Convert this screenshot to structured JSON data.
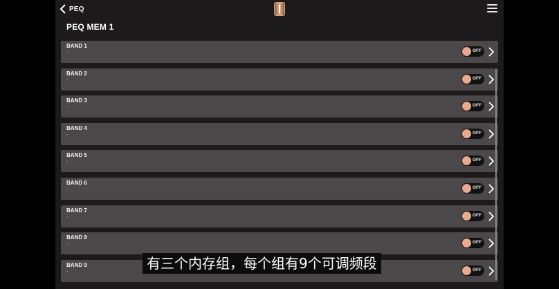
{
  "header": {
    "back_label": "PEQ",
    "logo": "brand-logo",
    "menu_icon": "hamburger-menu-icon"
  },
  "page_title": "PEQ MEM 1",
  "bands": [
    {
      "name": "BAND 1",
      "sub": "-",
      "toggle": "OFF"
    },
    {
      "name": "BAND 2",
      "sub": "-",
      "toggle": "OFF"
    },
    {
      "name": "BAND 3",
      "sub": "-",
      "toggle": "OFF"
    },
    {
      "name": "BAND 4",
      "sub": "-",
      "toggle": "OFF"
    },
    {
      "name": "BAND 5",
      "sub": "-",
      "toggle": "OFF"
    },
    {
      "name": "BAND 6",
      "sub": "-",
      "toggle": "OFF"
    },
    {
      "name": "BAND 7",
      "sub": "-",
      "toggle": "OFF"
    },
    {
      "name": "BAND 8",
      "sub": "-",
      "toggle": "OFF"
    },
    {
      "name": "BAND 9",
      "sub": "-",
      "toggle": "OFF"
    }
  ],
  "subtitle": "有三个内存组，每个组有9个可调频段",
  "colors": {
    "background": "#1c1a1b",
    "band_bg": "#4a4849",
    "toggle_knob": "#eaa98a",
    "toggle_track": "#121212"
  }
}
